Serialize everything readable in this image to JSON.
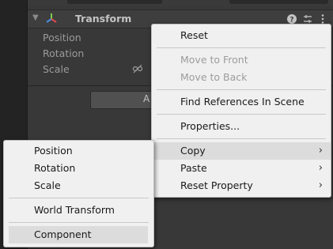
{
  "inspector": {
    "component": {
      "title": "Transform",
      "properties": [
        "Position",
        "Rotation",
        "Scale"
      ]
    },
    "add_button_label_partial": "A"
  },
  "context_menu": {
    "items": [
      {
        "label": "Reset",
        "enabled": true
      },
      {
        "label": "Move to Front",
        "enabled": false
      },
      {
        "label": "Move to Back",
        "enabled": false
      },
      {
        "label": "Find References In Scene",
        "enabled": true
      },
      {
        "label": "Properties...",
        "enabled": true
      },
      {
        "label": "Copy",
        "enabled": true,
        "submenu": true,
        "highlighted": true
      },
      {
        "label": "Paste",
        "enabled": true,
        "submenu": true
      },
      {
        "label": "Reset Property",
        "enabled": true,
        "submenu": true
      }
    ]
  },
  "copy_submenu": {
    "items": [
      {
        "label": "Position"
      },
      {
        "label": "Rotation"
      },
      {
        "label": "Scale"
      },
      {
        "label": "World Transform"
      },
      {
        "label": "Component",
        "highlighted": true
      }
    ]
  },
  "colors": {
    "menu_bg": "#f0f0f0",
    "menu_highlight": "#dcdcdc",
    "inspector_bg": "#383838"
  }
}
